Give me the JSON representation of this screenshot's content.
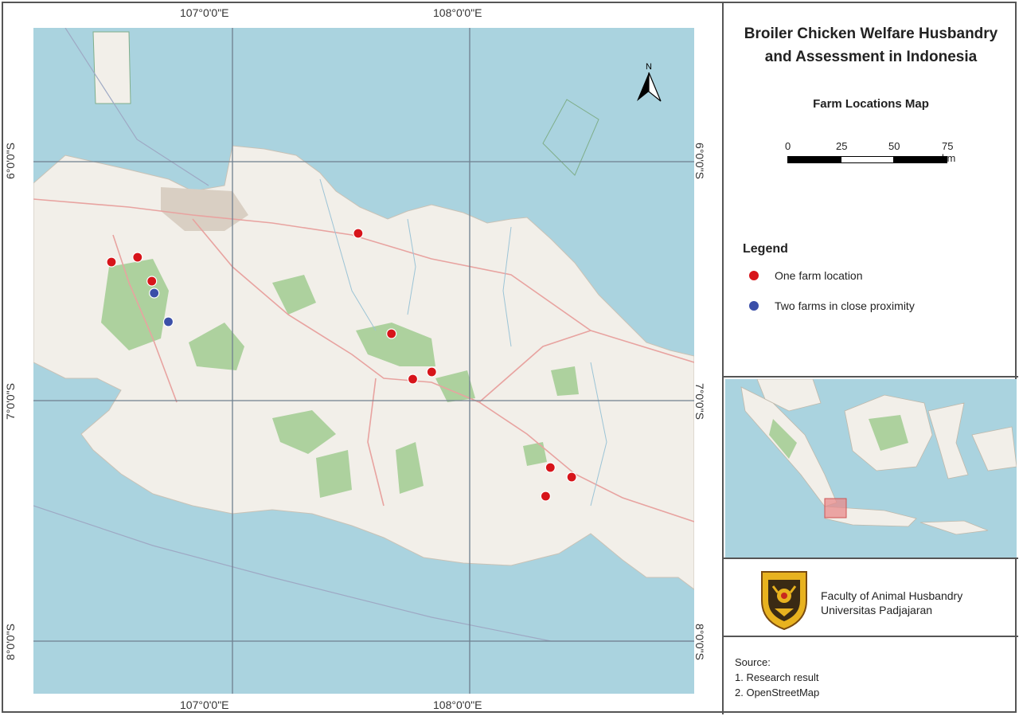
{
  "map": {
    "title_line1": "Broiler Chicken Welfare Husbandry",
    "title_line2": "and Assessment in Indonesia",
    "subtitle": "Farm Locations Map",
    "coord_labels": {
      "lon_107": "107°0'0\"E",
      "lon_108": "108°0'0\"E",
      "lat_6": "6°0'0\"S",
      "lat_7": "7°0'0\"S",
      "lat_8": "8°0'0\"S"
    },
    "north_arrow_label": "N",
    "scale": {
      "labels": [
        "0",
        "25",
        "50",
        "75 km"
      ]
    },
    "colors": {
      "sea": "#aad3df",
      "land": "#f2efe9",
      "forest": "#add19e",
      "road": "#e8a3a0",
      "grid": "#6f7f8f",
      "farm_single": "#d7141a",
      "farm_double": "#3b4fa8"
    },
    "farm_points": [
      {
        "lon": 106.49,
        "lat": -6.42,
        "type": "single"
      },
      {
        "lon": 106.6,
        "lat": -6.4,
        "type": "single"
      },
      {
        "lon": 106.66,
        "lat": -6.5,
        "type": "single"
      },
      {
        "lon": 106.67,
        "lat": -6.55,
        "type": "double"
      },
      {
        "lon": 106.73,
        "lat": -6.67,
        "type": "double"
      },
      {
        "lon": 107.53,
        "lat": -6.3,
        "type": "single"
      },
      {
        "lon": 107.67,
        "lat": -6.72,
        "type": "single"
      },
      {
        "lon": 107.76,
        "lat": -6.91,
        "type": "single"
      },
      {
        "lon": 107.84,
        "lat": -6.88,
        "type": "single"
      },
      {
        "lon": 108.34,
        "lat": -7.28,
        "type": "single"
      },
      {
        "lon": 108.43,
        "lat": -7.32,
        "type": "single"
      },
      {
        "lon": 108.32,
        "lat": -7.4,
        "type": "single"
      }
    ]
  },
  "legend": {
    "title": "Legend",
    "single_label": "One farm location",
    "double_label": "Two farms in close proximity"
  },
  "organization": {
    "line1": "Faculty of Animal Husbandry",
    "line2": "Universitas Padjajaran"
  },
  "source": {
    "heading": "Source:",
    "item1": "1. Research result",
    "item2": "2. OpenStreetMap"
  }
}
